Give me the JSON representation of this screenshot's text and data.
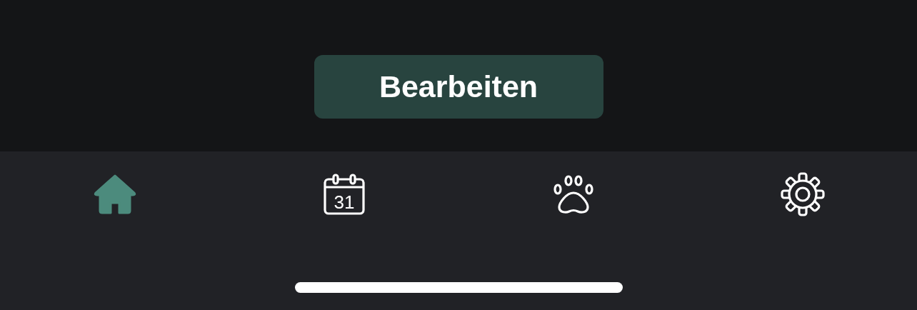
{
  "edit_button": {
    "label": "Bearbeiten"
  },
  "tabs": [
    {
      "kind": "home",
      "selected": true
    },
    {
      "kind": "calendar",
      "day": "31",
      "selected": false
    },
    {
      "kind": "paw",
      "selected": false
    },
    {
      "kind": "settings",
      "selected": false
    }
  ]
}
